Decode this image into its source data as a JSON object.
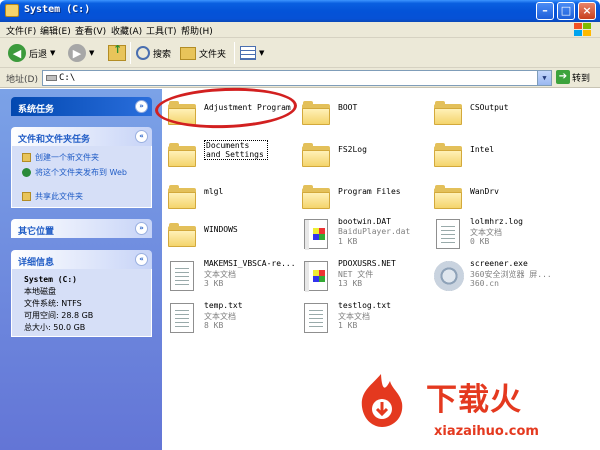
{
  "window": {
    "title": "System (C:)"
  },
  "menu": [
    "文件(F)",
    "编辑(E)",
    "查看(V)",
    "收藏(A)",
    "工具(T)",
    "帮助(H)"
  ],
  "toolbar": {
    "back": "后退",
    "search": "搜索",
    "folders": "文件夹"
  },
  "address": {
    "label": "地址(D)",
    "value": "C:\\",
    "go": "转到"
  },
  "left_pane": {
    "system_tasks": {
      "title": "系统任务"
    },
    "file_tasks": {
      "title": "文件和文件夹任务",
      "items": [
        "创建一个新文件夹",
        "将这个文件夹发布到 Web",
        "共享此文件夹"
      ]
    },
    "other_places": {
      "title": "其它位置"
    },
    "details": {
      "title": "详细信息",
      "name": "System (C:)",
      "type": "本地磁盘",
      "fs": "文件系统: NTFS",
      "free": "可用空间: 28.8 GB",
      "total": "总大小: 50.0 GB"
    }
  },
  "files": [
    {
      "name": "Adjustment Program",
      "kind": "folder"
    },
    {
      "name": "BOOT",
      "kind": "folder"
    },
    {
      "name": "CSOutput",
      "kind": "folder"
    },
    {
      "name": "Documents and Settings",
      "kind": "folder"
    },
    {
      "name": "FS2Log",
      "kind": "folder"
    },
    {
      "name": "Intel",
      "kind": "folder"
    },
    {
      "name": "mlgl",
      "kind": "folder"
    },
    {
      "name": "Program Files",
      "kind": "folder"
    },
    {
      "name": "WanDrv",
      "kind": "folder"
    },
    {
      "name": "WINDOWS",
      "kind": "folder"
    },
    {
      "name": "bootwin.DAT",
      "kind": "dat",
      "sub1": "BaiduPlayer.dat",
      "sub2": "1 KB"
    },
    {
      "name": "lolmhrz.log",
      "kind": "text",
      "sub1": "文本文档",
      "sub2": "0 KB"
    },
    {
      "name": "MAKEMSI_VBSCA-re...",
      "kind": "text",
      "sub1": "文本文档",
      "sub2": "3 KB"
    },
    {
      "name": "PDOXUSRS.NET",
      "kind": "net",
      "sub1": "NET 文件",
      "sub2": "13 KB"
    },
    {
      "name": "screener.exe",
      "kind": "exe",
      "sub1": "360安全浏览器 屏...",
      "sub2": "360.cn"
    },
    {
      "name": "temp.txt",
      "kind": "text",
      "sub1": "文本文档",
      "sub2": "8 KB"
    },
    {
      "name": "testlog.txt",
      "kind": "text",
      "sub1": "文本文档",
      "sub2": "1 KB"
    }
  ],
  "watermark": {
    "brand": "下载火",
    "url": "xiazaihuo.com"
  },
  "colors": {
    "titlebar": "#0453d8",
    "pane": "#6375d6",
    "accent_red": "#e4391f"
  }
}
